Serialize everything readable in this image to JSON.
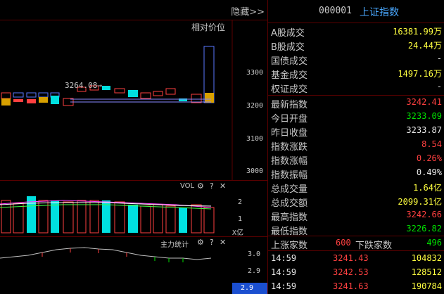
{
  "header": {
    "hide_label": "隐藏>>",
    "price_axis_label": "相对价位"
  },
  "chart": {
    "y_ticks": [
      "3300",
      "3200",
      "3100",
      "3000"
    ],
    "marker_label": "3264.08→"
  },
  "vol_panel": {
    "title": "VOL",
    "gear_icon": "⚙",
    "help_icon": "?",
    "close_icon": "✕",
    "y_ticks": [
      "2",
      "1"
    ],
    "unit": "X亿"
  },
  "power_panel": {
    "title": "主力统计",
    "gear_icon": "⚙",
    "help_icon": "?",
    "close_icon": "✕",
    "y_ticks": [
      "3.0",
      "2.9"
    ],
    "current_value": "2.9"
  },
  "quote": {
    "code": "000001",
    "name": "上证指数",
    "rows1": [
      {
        "label": "A股成交",
        "value": "16381.99",
        "unit": "万",
        "color": "yellow"
      },
      {
        "label": "B股成交",
        "value": "24.44",
        "unit": "万",
        "color": "yellow"
      },
      {
        "label": "国债成交",
        "value": "-",
        "unit": "",
        "color": "white"
      },
      {
        "label": "基金成交",
        "value": "1497.16",
        "unit": "万",
        "color": "yellow"
      },
      {
        "label": "权证成交",
        "value": "-",
        "unit": "",
        "color": "white"
      }
    ],
    "rows2": [
      {
        "label": "最新指数",
        "value": "3242.41",
        "color": "red"
      },
      {
        "label": "今日开盘",
        "value": "3233.09",
        "color": "green"
      },
      {
        "label": "昨日收盘",
        "value": "3233.87",
        "color": "white"
      },
      {
        "label": "指数涨跌",
        "value": "8.54",
        "color": "red"
      },
      {
        "label": "指数涨幅",
        "value": "0.26%",
        "color": "red"
      },
      {
        "label": "指数振幅",
        "value": "0.49%",
        "color": "white"
      },
      {
        "label": "总成交量",
        "value": "1.64",
        "unit": "亿",
        "color": "yellow"
      },
      {
        "label": "总成交额",
        "value": "2099.31",
        "unit": "亿",
        "color": "yellow"
      },
      {
        "label": "最高指数",
        "value": "3242.66",
        "color": "red"
      },
      {
        "label": "最低指数",
        "value": "3226.82",
        "color": "green"
      }
    ],
    "breadth": {
      "up_label": "上涨家数",
      "up_value": "600",
      "down_label": "下跌家数",
      "down_value": "496"
    },
    "ticks": [
      {
        "time": "14:59",
        "price": "3241.43",
        "volume": "104832"
      },
      {
        "time": "14:59",
        "price": "3242.53",
        "volume": "128512"
      },
      {
        "time": "14:59",
        "price": "3241.63",
        "volume": "190784"
      }
    ]
  }
}
